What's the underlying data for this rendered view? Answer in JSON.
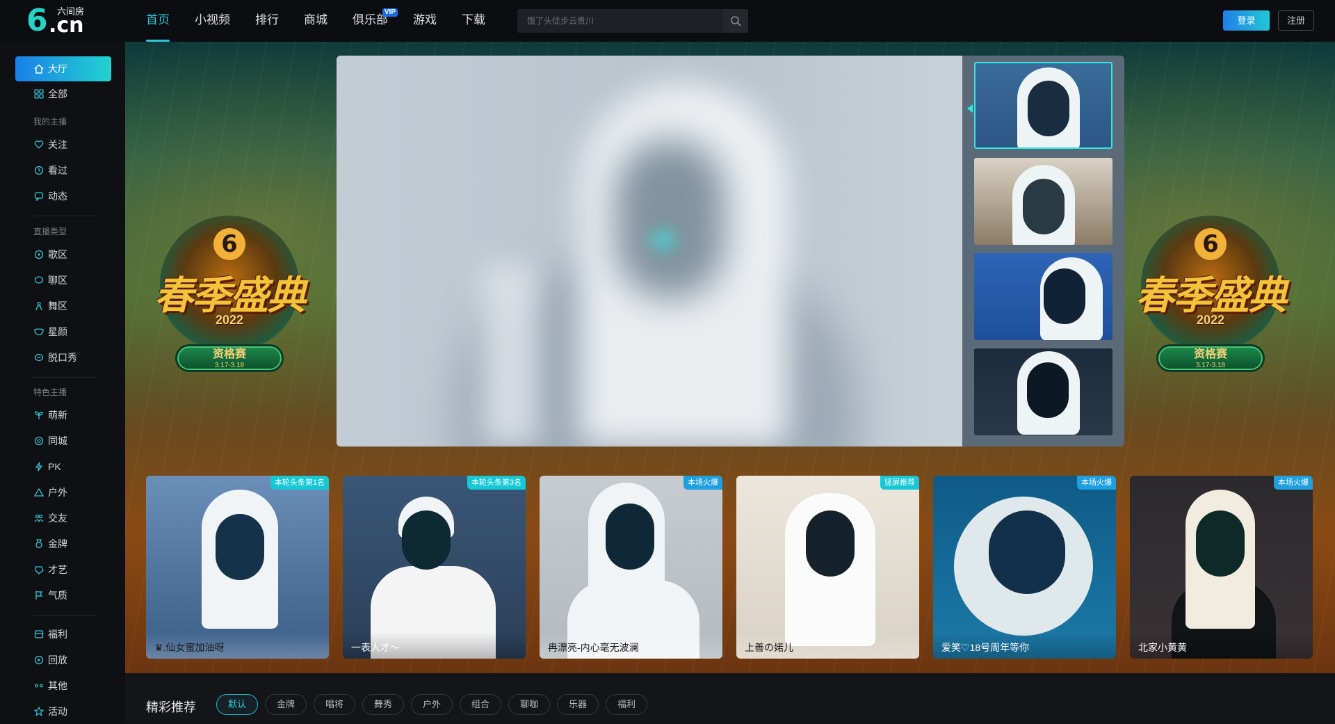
{
  "logo": {
    "brand": "6.cn",
    "six": "6",
    "dotcn": ".cn",
    "cn_name": "六间房"
  },
  "nav": {
    "items": [
      {
        "label": "首页",
        "active": true
      },
      {
        "label": "小视频"
      },
      {
        "label": "排行"
      },
      {
        "label": "商城"
      },
      {
        "label": "俱乐部",
        "badge": "VIP"
      },
      {
        "label": "游戏"
      },
      {
        "label": "下载"
      }
    ]
  },
  "search": {
    "placeholder": "饿了头徒步云贵川",
    "icon": "search-icon"
  },
  "auth": {
    "login": "登录",
    "register": "注册"
  },
  "sidebar": {
    "main": [
      {
        "label": "大厅",
        "icon": "home-icon",
        "active": true
      },
      {
        "label": "全部",
        "icon": "grid-icon"
      }
    ],
    "group_my": "我的主播",
    "my": [
      {
        "label": "关注",
        "icon": "heart-icon"
      },
      {
        "label": "看过",
        "icon": "clock-icon"
      },
      {
        "label": "动态",
        "icon": "message-icon"
      }
    ],
    "group_type": "直播类型",
    "types": [
      {
        "label": "歌区",
        "icon": "music-disc-icon"
      },
      {
        "label": "聊区",
        "icon": "chat-icon"
      },
      {
        "label": "舞区",
        "icon": "dancer-icon"
      },
      {
        "label": "星颜",
        "icon": "mask-icon"
      },
      {
        "label": "脱口秀",
        "icon": "mic-bubble-icon"
      }
    ],
    "group_feature": "特色主播",
    "features": [
      {
        "label": "萌新",
        "icon": "sprout-icon"
      },
      {
        "label": "同城",
        "icon": "location-icon"
      },
      {
        "label": "PK",
        "icon": "lightning-icon"
      },
      {
        "label": "户外",
        "icon": "mountain-icon"
      },
      {
        "label": "交友",
        "icon": "users-icon"
      },
      {
        "label": "金牌",
        "icon": "medal-icon"
      },
      {
        "label": "才艺",
        "icon": "palette-icon"
      },
      {
        "label": "气质",
        "icon": "flag-icon"
      }
    ],
    "others": [
      {
        "label": "福利",
        "icon": "gift-box-icon"
      },
      {
        "label": "回放",
        "icon": "replay-icon"
      },
      {
        "label": "其他",
        "icon": "dots-icon"
      },
      {
        "label": "活动",
        "icon": "star-icon"
      }
    ]
  },
  "banner": {
    "emblem_title": "春季盛典",
    "emblem_year": "2022",
    "emblem_stage": "资格赛",
    "emblem_dates": "3.17-3.18"
  },
  "cards": [
    {
      "name": "♛.仙女蜜加油呀",
      "tag": "本轮头条第1名"
    },
    {
      "name": "一表人才～",
      "tag": "本轮头条第3名"
    },
    {
      "name": "冉漂亮-内心毫无波澜",
      "tag": "本场火爆"
    },
    {
      "name": "上善の婼儿",
      "tag": "竖屏推荐"
    },
    {
      "name": "爱笑♡18号周年等你",
      "tag": "本场火爆"
    },
    {
      "name": "北家小黄黄",
      "tag": "本场火爆"
    }
  ],
  "recommend": {
    "title": "精彩推荐",
    "chips": [
      "默认",
      "金牌",
      "唱将",
      "舞秀",
      "户外",
      "组合",
      "聊咖",
      "乐器",
      "福利"
    ],
    "active_chip": "默认"
  },
  "colors": {
    "accent": "#29c8e0",
    "brand_gradient_start": "#1a7fe8",
    "brand_gradient_end": "#22d3d0"
  }
}
